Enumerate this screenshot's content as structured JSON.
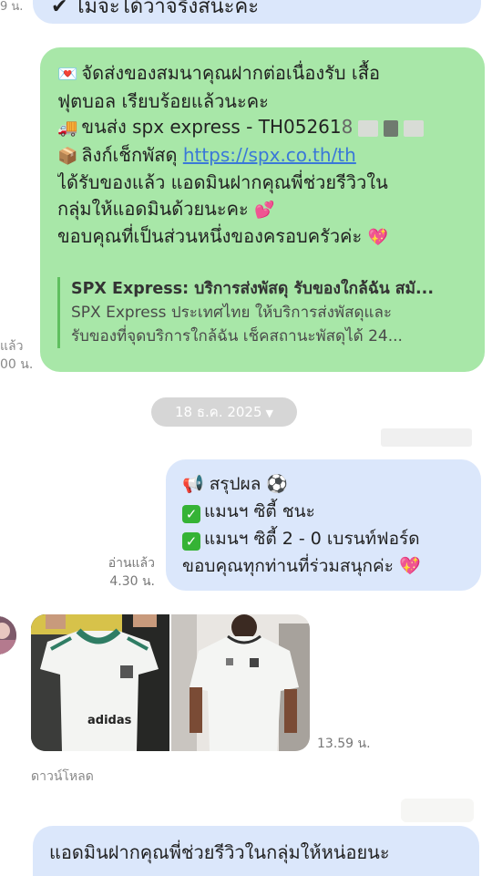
{
  "top_message": {
    "text": "ไม่จะได้ว่าจริงสนะคะ",
    "side_meta": "9 น."
  },
  "green_message": {
    "lines": [
      "จัดส่งของสมนาคุณฝากต่อเนื่องรับ เสื้อ",
      "ฟุตบอล เรียบร้อยแล้วนะคะ",
      "ขนส่ง spx express - TH05261",
      "ลิงก์เช็กพัสดุ",
      "ได้รับของแล้ว แอดมินฝากคุณพี่ช่วยรีวิวใน",
      "กลุ่มให้แอดมินด้วยนะคะ",
      "ขอบคุณที่เป็นส่วนหนึ่งของครอบครัวค่ะ"
    ],
    "tracking_partial": "8",
    "link_text": "https://spx.co.th/th",
    "preview_title": "SPX Express: บริการส่งพัสดุ รับของใกล้ฉัน สมั...",
    "preview_desc_1": "SPX Express ประเทศไทย ให้บริการส่งพัสดุและ",
    "preview_desc_2": "รับของที่จุดบริการใกล้ฉัน เช็คสถานะพัสดุได้ 24...",
    "side_meta_1": "แล้ว",
    "side_meta_2": "00 น."
  },
  "date_separator": "18 ธ.ค. 2025",
  "blue_message": {
    "lines": [
      "สรุปผล",
      "แมนฯ ซิตี้ ชนะ",
      "แมนฯ ซิตี้ 2 - 0 เบรนท์ฟอร์ด",
      "ขอบคุณทุกท่านที่ร่วมสนุกค่ะ"
    ],
    "read_label": "อ่านแล้ว",
    "time": "4.30 น."
  },
  "photo_message": {
    "time": "13.59 น.",
    "download_label": "ดาวน์โหลด"
  },
  "bottom_message": {
    "text": "แอดมินฝากคุณพี่ช่วยรีวิวในกลุ่มให้หน่อยนะ"
  },
  "colors": {
    "green_bubble": "#a8e7a8",
    "blue_bubble": "#dbe7fb",
    "link": "#3a78d8",
    "date_pill": "#d6d6d6"
  }
}
